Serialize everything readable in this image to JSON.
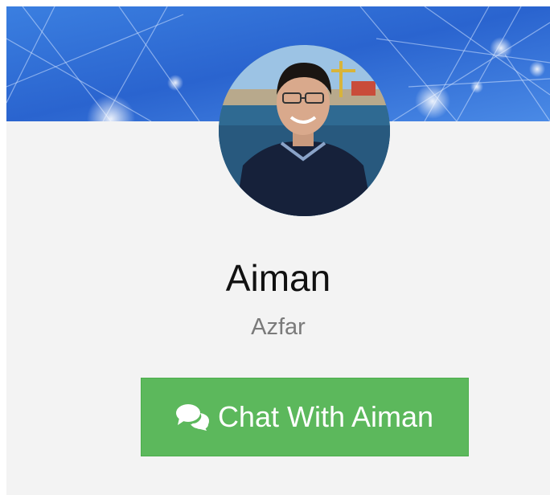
{
  "profile": {
    "first_name": "Aiman",
    "last_name": "Azfar",
    "avatar_icon": "profile-photo"
  },
  "chat_button": {
    "label": "Chat With Aiman",
    "icon": "comments-icon",
    "color": "#5cb85c"
  },
  "colors": {
    "card_background": "#f3f3f3",
    "banner_blue": "#2f6fd8"
  }
}
